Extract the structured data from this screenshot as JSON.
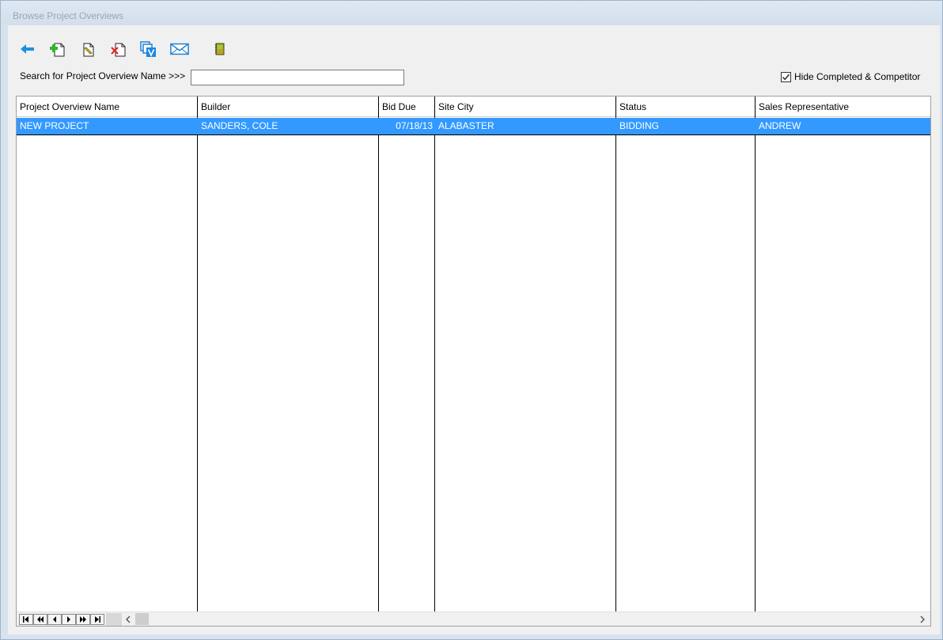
{
  "window": {
    "title": "Browse Project Overviews"
  },
  "toolbar": {
    "buttons": [
      {
        "icon": "back-arrow-icon"
      },
      {
        "icon": "add-document-icon"
      },
      {
        "icon": "edit-document-icon"
      },
      {
        "icon": "delete-document-icon"
      },
      {
        "icon": "view-copies-icon"
      },
      {
        "icon": "email-icon"
      },
      {
        "icon": "notebook-icon"
      }
    ]
  },
  "search": {
    "label": "Search for Project Overview Name >>>",
    "value": "",
    "placeholder": ""
  },
  "filter": {
    "hide_completed_label": "Hide Completed & Competitor",
    "hide_completed_checked": true
  },
  "grid": {
    "columns": [
      "Project Overview Name",
      "Builder",
      "Bid Due",
      "Site City",
      "Status",
      "Sales Representative"
    ],
    "rows": [
      {
        "name": "NEW PROJECT",
        "builder": "SANDERS, COLE",
        "bid_due": "07/18/13",
        "site_city": "ALABASTER",
        "status": "BIDDING",
        "sales_rep": "ANDREW",
        "selected": true
      }
    ]
  },
  "colors": {
    "selection": "#3399ff",
    "window_frame": "#d6e2ee",
    "client_bg": "#f0f0f0"
  }
}
